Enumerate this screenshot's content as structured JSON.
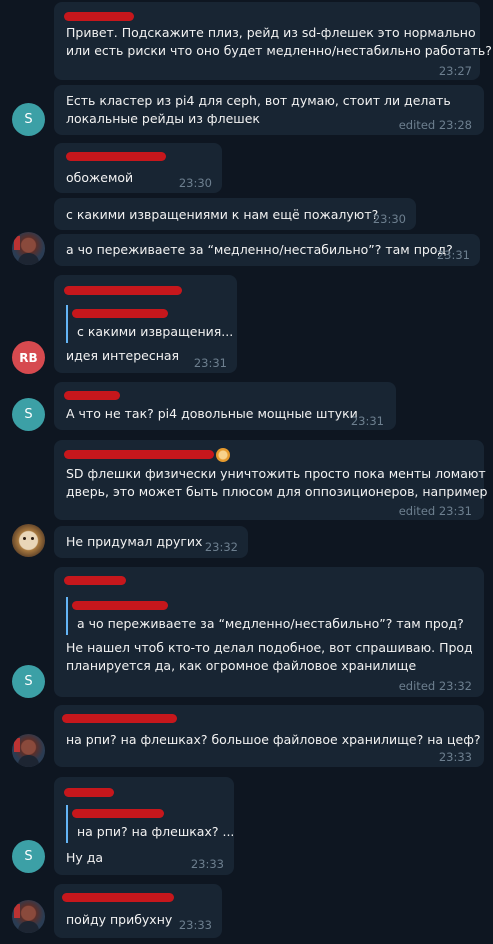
{
  "messages": [
    {
      "id": "m1",
      "lines": [
        "Привет. Подскажите плиз, рейд из sd-флешек это нормально",
        "или есть риски что оно будет медленно/нестабильно работать?"
      ],
      "time": "23:27"
    },
    {
      "id": "m2",
      "avatar": "S",
      "lines": [
        "Есть кластер из pi4 для ceph, вот думаю, стоит ли делать",
        "локальные рейды из флешек"
      ],
      "time": "edited 23:28"
    },
    {
      "id": "m3",
      "lines": [
        "обожемой"
      ],
      "time": "23:30"
    },
    {
      "id": "m4",
      "lines": [
        "с какими извращениями к нам ещё пожалуют?"
      ],
      "time": "23:30"
    },
    {
      "id": "m5",
      "lines": [
        "а чо переживаете за “медленно/нестабильно”? там прод?"
      ],
      "time": "23:31"
    },
    {
      "id": "m6",
      "avatar": "RB",
      "quote": "с какими извращения...",
      "lines": [
        "идея интересная"
      ],
      "time": "23:31"
    },
    {
      "id": "m7",
      "avatar": "S",
      "lines": [
        "А что не так? pi4 довольные мощные штуки"
      ],
      "time": "23:31"
    },
    {
      "id": "m8",
      "lines": [
        "SD флешки физически уничтожить просто пока менты ломают",
        "дверь, это может быть плюсом для оппозиционеров, например"
      ],
      "time": "edited 23:31"
    },
    {
      "id": "m9",
      "lines": [
        "Не придумал других"
      ],
      "time": "23:32"
    },
    {
      "id": "m10",
      "avatar": "S",
      "quote": "а чо переживаете за “медленно/нестабильно”? там прод?",
      "lines": [
        "Не нашел чтоб кто-то делал подобное, вот спрашиваю. Прод",
        "планируется да, как огромное файловое хранилище"
      ],
      "time": "edited 23:32"
    },
    {
      "id": "m11",
      "lines": [
        "на рпи? на флешках? большое файловое хранилище? на цеф?"
      ],
      "time": "23:33"
    },
    {
      "id": "m12",
      "avatar": "S",
      "quote": "на рпи? на флешках? ...",
      "lines": [
        "Ну да"
      ],
      "time": "23:33"
    },
    {
      "id": "m13",
      "lines": [
        "пойду прибухну"
      ],
      "time": "23:33"
    }
  ]
}
